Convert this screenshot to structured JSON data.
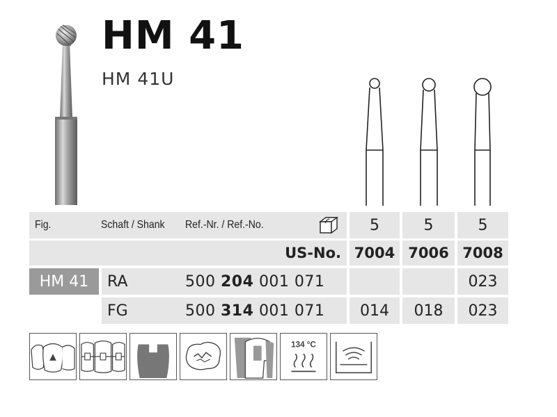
{
  "product": {
    "title": "HM 41",
    "subtitle": "HM 41U"
  },
  "table": {
    "header": {
      "fig_label": "Fig.",
      "shank_label": "Schaft / Shank",
      "ref_label": "Ref.-Nr. / Ref.-No.",
      "package_icon": "package-box-icon",
      "qty": [
        "5",
        "5",
        "5"
      ]
    },
    "us_row": {
      "label": "US-No.",
      "values": [
        "7004",
        "7006",
        "7008"
      ]
    },
    "rows": [
      {
        "group": "HM 41",
        "shank": "RA",
        "ref_prefix": "500",
        "ref_bold": "204",
        "ref_suffix": "001 071",
        "sizes": [
          "",
          "",
          "023"
        ]
      },
      {
        "group": "",
        "shank": "FG",
        "ref_prefix": "500",
        "ref_bold": "314",
        "ref_suffix": "001 071",
        "sizes": [
          "014",
          "018",
          "023"
        ]
      }
    ]
  },
  "icons": {
    "items": [
      "tooth-cavity-icon",
      "orthodontic-brackets-icon",
      "cavity-preparation-icon",
      "occlusal-surface-icon",
      "crown-preparation-icon",
      "sterilization-icon",
      "ultrasonic-bath-icon"
    ],
    "sterilization_temp": "134 °C"
  },
  "colors": {
    "cell_bg": "#e6e6e6",
    "group_bg": "#9a9a9a",
    "text": "#1a1a1a"
  }
}
